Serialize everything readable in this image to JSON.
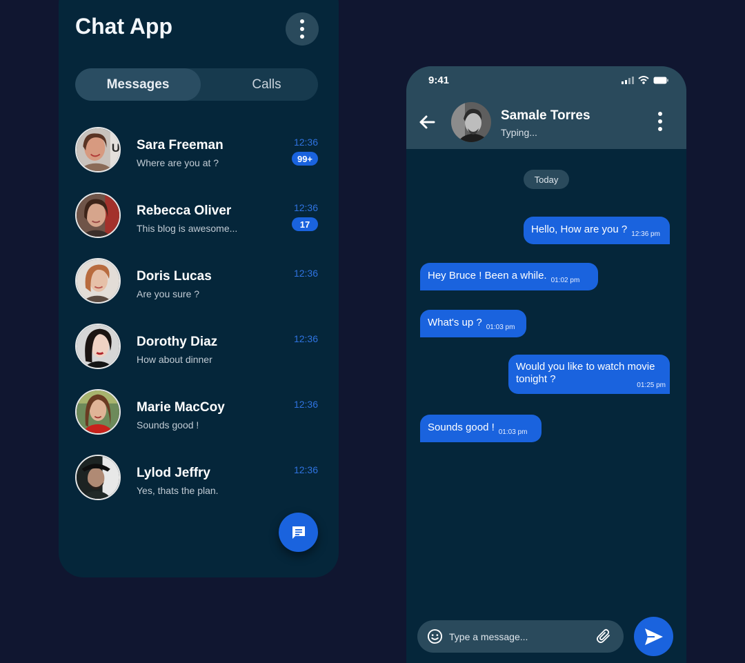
{
  "colors": {
    "background": "#101630",
    "panel": "#05263a",
    "panel_light": "#2a4a5c",
    "accent": "#1a63de",
    "time_text": "#2f73e0"
  },
  "list": {
    "title": "Chat App",
    "tabs": [
      {
        "label": "Messages",
        "active": true
      },
      {
        "label": "Calls",
        "active": false
      }
    ],
    "contacts": [
      {
        "name": "Sara Freeman",
        "message": "Where are you at ?",
        "time": "12:36",
        "badge": "99+"
      },
      {
        "name": "Rebecca Oliver",
        "message": "This blog is awesome...",
        "time": "12:36",
        "badge": "17"
      },
      {
        "name": "Doris Lucas",
        "message": "Are you sure ?",
        "time": "12:36",
        "badge": ""
      },
      {
        "name": "Dorothy Diaz",
        "message": "How about dinner",
        "time": "12:36",
        "badge": ""
      },
      {
        "name": "Marie MacCoy",
        "message": "Sounds good !",
        "time": "12:36",
        "badge": ""
      },
      {
        "name": "Lylod Jeffry",
        "message": "Yes, thats the plan.",
        "time": "12:36",
        "badge": ""
      }
    ],
    "fab_icon": "message-icon"
  },
  "chat": {
    "status_time": "9:41",
    "contact_name": "Samale Torres",
    "contact_status": "Typing...",
    "day_label": "Today",
    "messages": [
      {
        "direction": "sent",
        "text": "Hello, How are you ?",
        "time": "12:36 pm"
      },
      {
        "direction": "received",
        "text": "Hey Bruce ! Been a while.",
        "time": "01:02 pm"
      },
      {
        "direction": "received",
        "text": "What's up ?",
        "time": "01:03 pm"
      },
      {
        "direction": "sent",
        "text": "Would you like to watch movie tonight ?",
        "time": "01:25 pm"
      },
      {
        "direction": "received",
        "text": "Sounds good !",
        "time": "01:03 pm"
      }
    ],
    "composer": {
      "placeholder": "Type a message...",
      "emoji_icon": "emoji-icon",
      "attach_icon": "paperclip-icon",
      "send_icon": "send-icon"
    }
  }
}
